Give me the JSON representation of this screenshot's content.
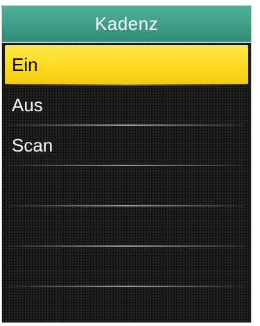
{
  "title": "Kadenz",
  "menu": {
    "items": [
      {
        "label": "Ein",
        "selected": true
      },
      {
        "label": "Aus",
        "selected": false
      },
      {
        "label": "Scan",
        "selected": false
      }
    ]
  },
  "colors": {
    "title_bar": "#3f9d86",
    "selected_bg": "#fad81f",
    "background": "#141414"
  }
}
